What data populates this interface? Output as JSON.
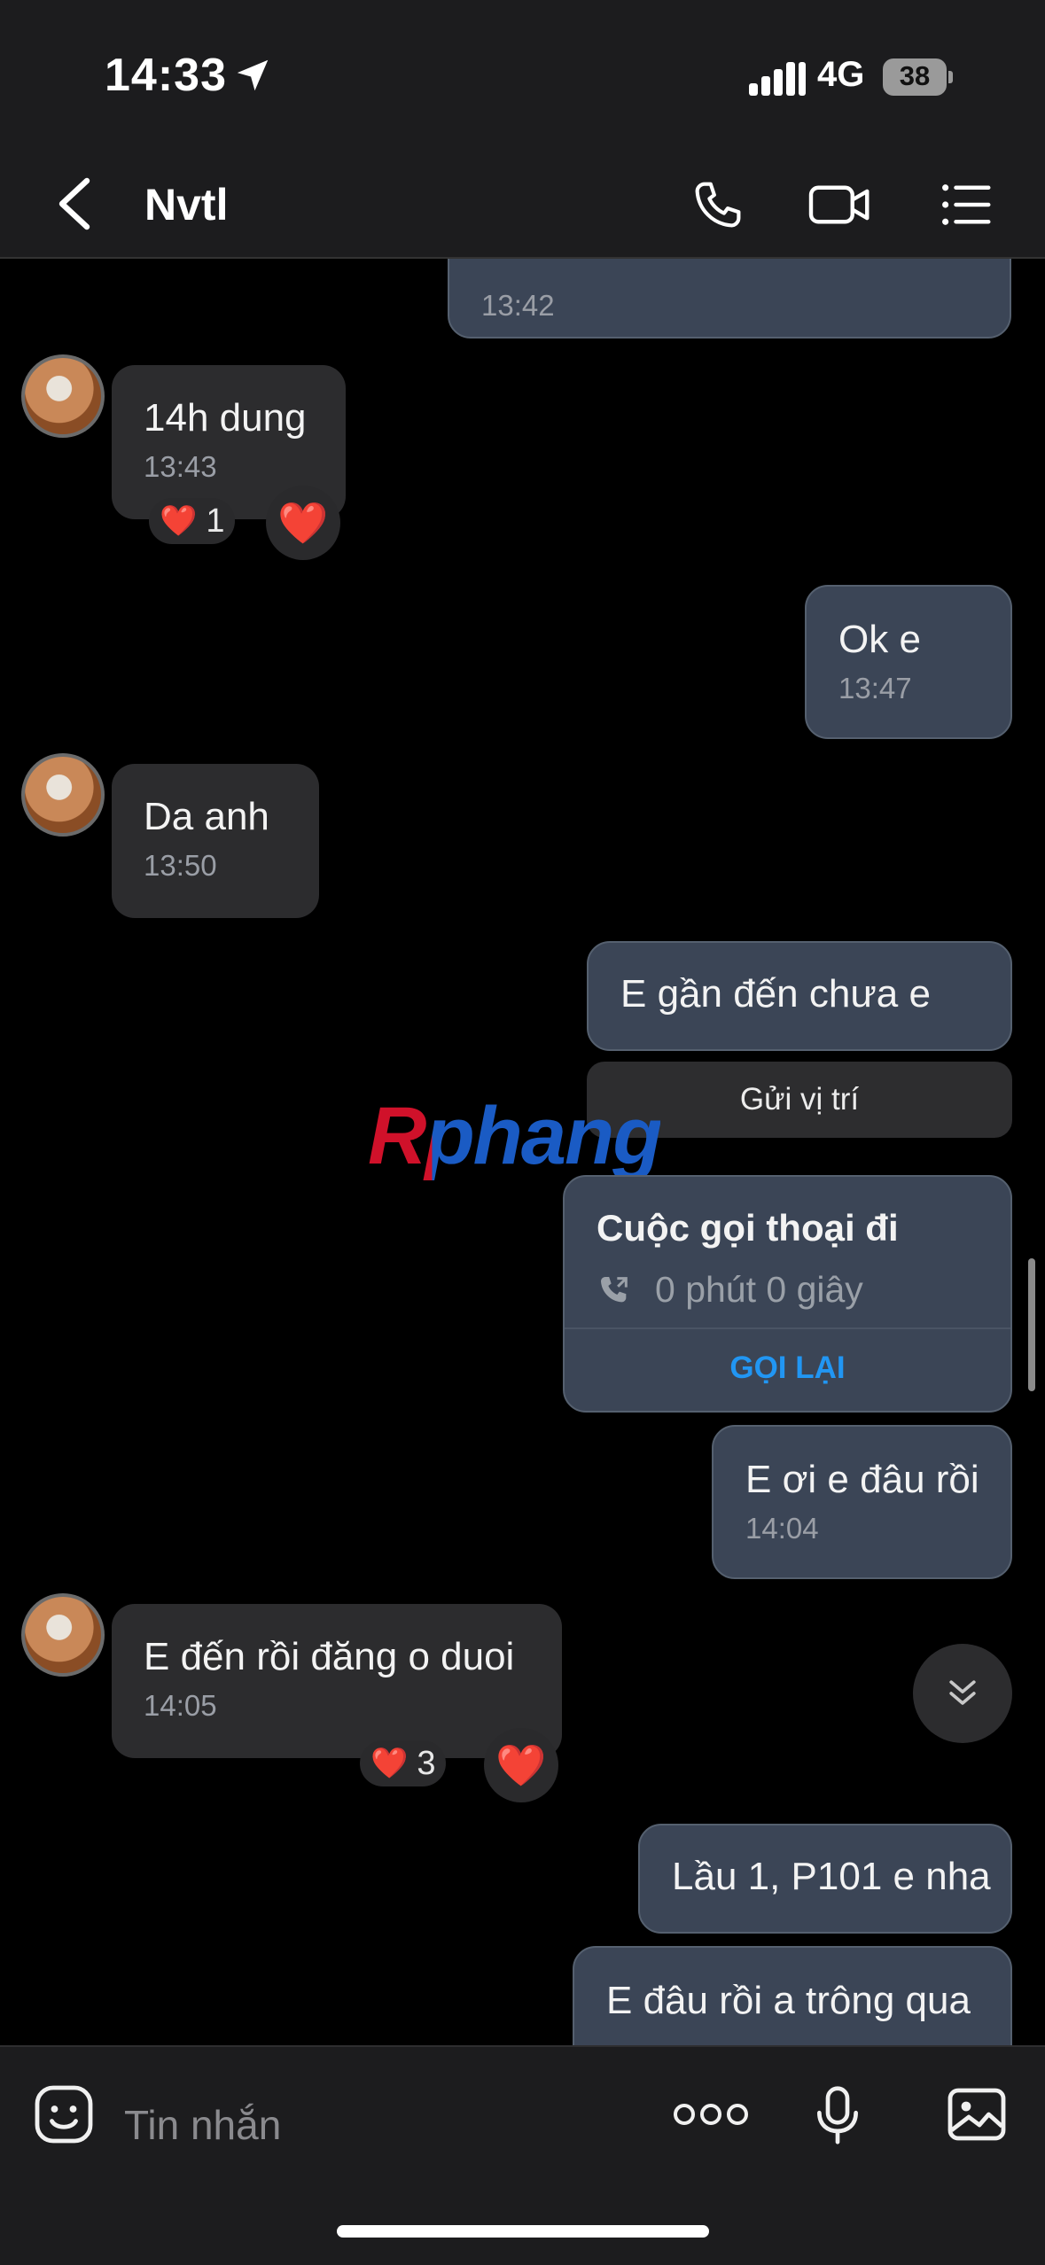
{
  "status_bar": {
    "time": "14:33",
    "network": "4G",
    "battery": "38"
  },
  "header": {
    "title": "Nvtl",
    "icons": [
      "back-icon",
      "phone-icon",
      "video-icon",
      "menu-icon"
    ]
  },
  "messages": [
    {
      "id": "m0",
      "direction": "out",
      "text": "",
      "time": "13:42"
    },
    {
      "id": "m1",
      "direction": "in",
      "text": "14h dung",
      "time": "13:43",
      "reaction": "❤️",
      "reaction_count": "1"
    },
    {
      "id": "m2",
      "direction": "out",
      "text": "Ok e",
      "time": "13:47"
    },
    {
      "id": "m3",
      "direction": "in",
      "text": "Da anh",
      "time": "13:50"
    },
    {
      "id": "m4",
      "direction": "out",
      "text": "E gần đến chưa e",
      "time": ""
    },
    {
      "id": "m5",
      "direction": "out",
      "text": "E ơi e đâu rồi",
      "time": "14:04"
    },
    {
      "id": "m6",
      "direction": "in",
      "text": "E đến rồi đăng o duoi",
      "time": "14:05",
      "reaction": "❤️",
      "reaction_count": "3"
    },
    {
      "id": "m7",
      "direction": "out",
      "text": "Lầu 1, P101 e nha",
      "time": ""
    },
    {
      "id": "m8",
      "direction": "out",
      "text": "E đâu rồi a trông qua",
      "time": ""
    }
  ],
  "location": {
    "label": "Gửi vị trí"
  },
  "call_card": {
    "title": "Cuộc gọi thoại đi",
    "duration": "0 phút 0 giây",
    "action": "GỌI LẠI"
  },
  "watermark": {
    "text": "Rphang"
  },
  "composer": {
    "placeholder": "Tin nhắn",
    "icons": [
      "sticker-icon",
      "more-icon",
      "mic-icon",
      "image-icon"
    ]
  },
  "colors": {
    "in_bubble": "#2c2c2e",
    "out_bubble": "#3b4556",
    "accent": "#2196f3",
    "heart": "#e8283b"
  }
}
